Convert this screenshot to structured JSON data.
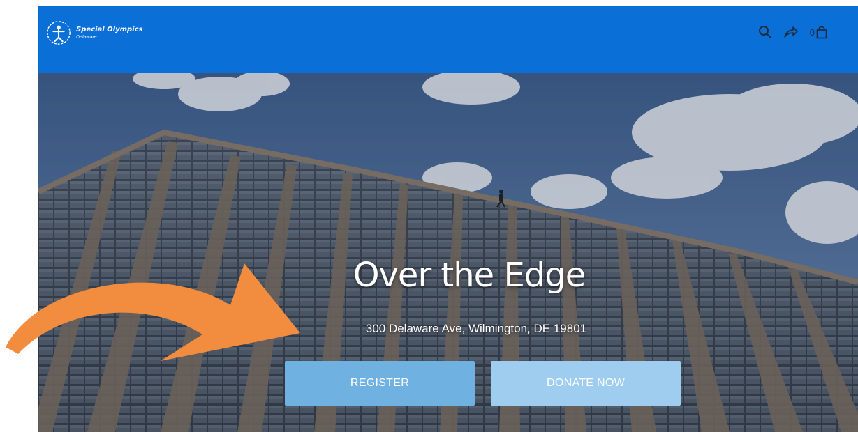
{
  "header": {
    "brand_name": "Special Olympics",
    "brand_sub": "Delaware",
    "cart_count": "0",
    "bg_color": "#0a6fd6"
  },
  "icons": {
    "logo": "special-olympics-logo-icon",
    "search": "search-icon",
    "share": "share-icon",
    "cart": "shopping-bag-icon"
  },
  "hero": {
    "title": "Over the Edge",
    "address": "300 Delaware Ave, Wilmington, DE 19801"
  },
  "buttons": {
    "register_label": "REGISTER",
    "donate_label": "DONATE NOW",
    "register_color": "#6fb2e2",
    "donate_color": "#9fcdf0"
  },
  "annotation": {
    "arrow_color": "#f28c3f"
  }
}
